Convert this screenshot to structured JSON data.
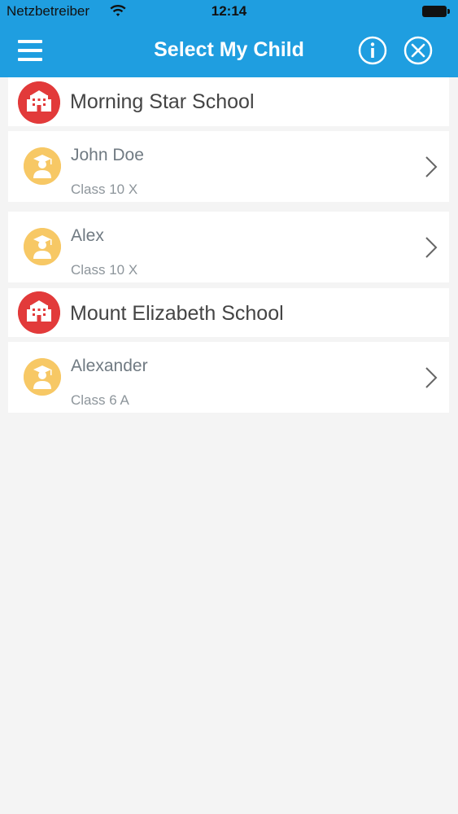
{
  "status": {
    "carrier": "Netzbetreiber",
    "time": "12:14"
  },
  "header": {
    "title": "Select My Child"
  },
  "schools": [
    {
      "name": "Morning Star School",
      "children": [
        {
          "name": "John Doe",
          "class": "Class 10 X"
        },
        {
          "name": "Alex",
          "class": "Class 10 X"
        }
      ]
    },
    {
      "name": "Mount Elizabeth School",
      "children": [
        {
          "name": "Alexander",
          "class": "Class 6 A"
        }
      ]
    }
  ],
  "colors": {
    "header": "#1f9ee0",
    "school_icon": "#e23a3a",
    "avatar": "#f7c865",
    "background": "#f4f4f4"
  }
}
